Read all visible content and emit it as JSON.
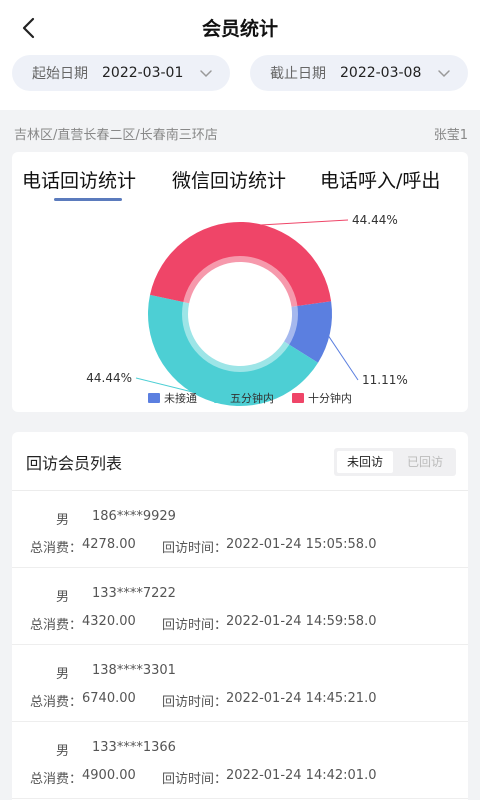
{
  "header": {
    "title": "会员统计"
  },
  "dates": {
    "start_label": "起始日期",
    "start_value": "2022-03-01",
    "end_label": "截止日期",
    "end_value": "2022-03-08"
  },
  "breadcrumb": {
    "path": "吉林区/直营长春二区/长春南三环店",
    "user": "张莹1"
  },
  "stats": {
    "tabs": [
      {
        "label": "电话回访统计",
        "active": true
      },
      {
        "label": "微信回访统计",
        "active": false
      },
      {
        "label": "电话呼入/呼出",
        "active": false
      }
    ]
  },
  "chart_data": {
    "type": "pie",
    "donut": true,
    "slices": [
      {
        "name": "未接通",
        "value": 11.11,
        "label": "11.11%",
        "color": "#5b7fe0"
      },
      {
        "name": "五分钟内",
        "value": 44.44,
        "label": "44.44%",
        "color": "#4dcfd4"
      },
      {
        "name": "十分钟内",
        "value": 44.44,
        "label": "44.44%",
        "color": "#ef4568"
      }
    ],
    "legend_position": "bottom-center"
  },
  "list": {
    "title": "回访会员列表",
    "seg_unvisited": "未回访",
    "seg_visited": "已回访",
    "spend_label": "总消费：",
    "time_label": "回访时间：",
    "rows": [
      {
        "gender": "男",
        "phone": "186****9929",
        "spend": "4278.00",
        "time": "2022-01-24 15:05:58.0"
      },
      {
        "gender": "男",
        "phone": "133****7222",
        "spend": "4320.00",
        "time": "2022-01-24 14:59:58.0"
      },
      {
        "gender": "男",
        "phone": "138****3301",
        "spend": "6740.00",
        "time": "2022-01-24 14:45:21.0"
      },
      {
        "gender": "男",
        "phone": "133****1366",
        "spend": "4900.00",
        "time": "2022-01-24 14:42:01.0"
      }
    ]
  }
}
